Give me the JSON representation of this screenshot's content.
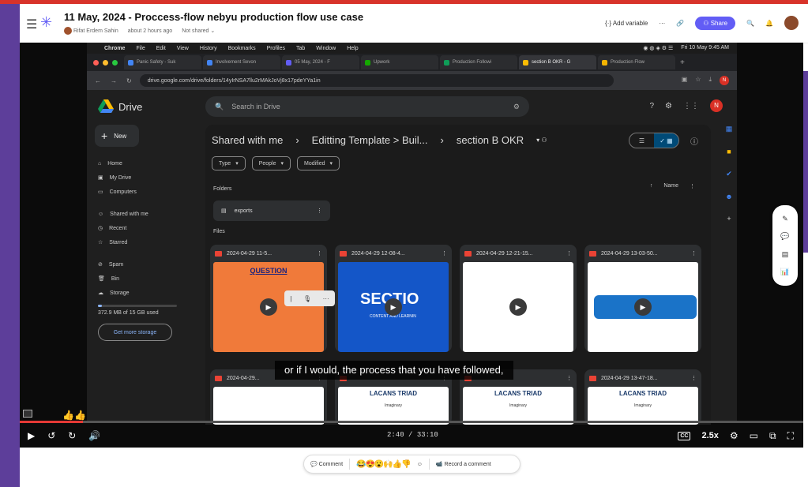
{
  "app": {
    "title": "11 May, 2024 - Proccess-flow nebyu production flow use case",
    "author": "Rifat Erdem Sahin",
    "updated": "about 2 hours ago",
    "sharing": "Not shared",
    "add_variable": "Add variable",
    "share": "Share",
    "accent": "#625df5"
  },
  "mac_menu": {
    "items": [
      "Chrome",
      "File",
      "Edit",
      "View",
      "History",
      "Bookmarks",
      "Profiles",
      "Tab",
      "Window",
      "Help"
    ],
    "clock": "Fri 10 May 9:45 AM"
  },
  "browser": {
    "tabs": [
      {
        "label": "Panic Safety - Suk",
        "color": "#4285f4"
      },
      {
        "label": "Involvement Sevon",
        "color": "#4285f4"
      },
      {
        "label": "05 May, 2024 - F",
        "color": "#625df5"
      },
      {
        "label": "Upwork",
        "color": "#14a800"
      },
      {
        "label": "Production Followi",
        "color": "#0f9d58"
      },
      {
        "label": "section B OKR - G",
        "color": "#fbbc04",
        "active": true
      },
      {
        "label": "Production Flow",
        "color": "#f4b400"
      }
    ],
    "url": "drive.google.com/drive/folders/14yIrNSA7llu2rMAkJoVj8x17pdeYYa1in"
  },
  "drive": {
    "product": "Drive",
    "search_placeholder": "Search in Drive",
    "account_initial": "N",
    "new_label": "New",
    "nav": [
      "Home",
      "My Drive",
      "Computers",
      "Shared with me",
      "Recent",
      "Starred",
      "Spam",
      "Bin",
      "Storage"
    ],
    "storage_used": "372.9 MB of 15 GB used",
    "get_storage": "Get more storage",
    "breadcrumb": [
      "Shared with me",
      "Editting Template > Buil...",
      "section B OKR"
    ],
    "filters": [
      "Type",
      "People",
      "Modified"
    ],
    "folders_label": "Folders",
    "files_label": "Files",
    "sort_label": "Name",
    "folder_name": "exports",
    "files": [
      {
        "name": "2024-04-29 11-5...",
        "thumb_text": "QUESTION",
        "thumb_bg": "#f07a3a"
      },
      {
        "name": "2024-04-29 12-08-4...",
        "thumb_text": "SECTIO",
        "thumb_sub": "CONTENT AND LEARNIN",
        "thumb_bg": "#1456c8"
      },
      {
        "name": "2024-04-29 12-21-15...",
        "thumb_text": "",
        "thumb_bg": "#ffffff"
      },
      {
        "name": "2024-04-29 13-03-50...",
        "thumb_text": "",
        "thumb_bg": "#ffffff"
      },
      {
        "name": "2024-04-29...",
        "thumb_text": "",
        "thumb_bg": "#ffffff"
      },
      {
        "name": "",
        "thumb_text": "LACANS TRIAD",
        "thumb_sub": "Imaginary",
        "thumb_bg": "#ffffff"
      },
      {
        "name": "",
        "thumb_text": "LACANS TRIAD",
        "thumb_sub": "Imaginary",
        "thumb_bg": "#ffffff"
      },
      {
        "name": "2024-04-29 13-47-18...",
        "thumb_text": "LACANS TRIAD",
        "thumb_sub": "Imaginary",
        "thumb_bg": "#ffffff"
      }
    ]
  },
  "player": {
    "subtitle": "or if I would, the process that you have followed,",
    "current_time": "2:40",
    "duration": "33:10",
    "progress": 0.0804,
    "speed": "2.5x",
    "cc": "CC"
  },
  "bottom_bar": {
    "comment": "Comment",
    "reactions": "😂😍😮🙌👍👎",
    "record": "Record a comment"
  }
}
